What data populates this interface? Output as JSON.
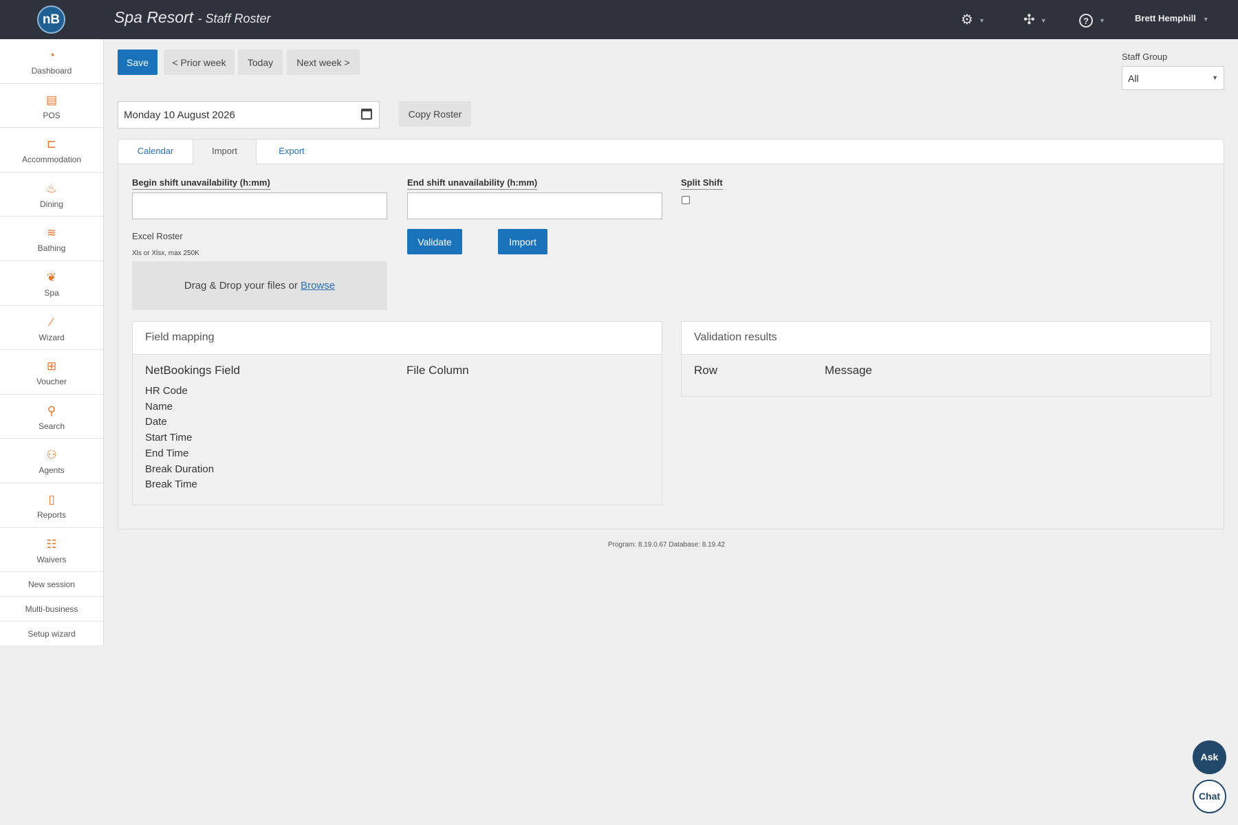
{
  "header": {
    "logo_text": "nB",
    "title": "Spa Resort",
    "subtitle": "- Staff Roster",
    "icons": [
      "settings-icon",
      "network-icon",
      "help-icon"
    ],
    "user": "Brett Hemphill"
  },
  "sidebar": {
    "items": [
      {
        "label": "Dashboard",
        "icon": "dashboard-icon",
        "glyph": "◔"
      },
      {
        "label": "POS",
        "icon": "pos-icon",
        "glyph": "▤"
      },
      {
        "label": "Accommodation",
        "icon": "bed-icon",
        "glyph": "⊏"
      },
      {
        "label": "Dining",
        "icon": "dining-icon",
        "glyph": "♨"
      },
      {
        "label": "Bathing",
        "icon": "waves-icon",
        "glyph": "≋"
      },
      {
        "label": "Spa",
        "icon": "lotus-icon",
        "glyph": "❦"
      },
      {
        "label": "Wizard",
        "icon": "magic-wand-icon",
        "glyph": "⁄"
      },
      {
        "label": "Voucher",
        "icon": "gift-icon",
        "glyph": "⊞"
      },
      {
        "label": "Search",
        "icon": "search-icon",
        "glyph": "⚲"
      },
      {
        "label": "Agents",
        "icon": "agents-icon",
        "glyph": "⚇"
      },
      {
        "label": "Reports",
        "icon": "report-icon",
        "glyph": "▯"
      },
      {
        "label": "Waivers",
        "icon": "checklist-icon",
        "glyph": "☷"
      }
    ],
    "links": [
      "New session",
      "Multi-business",
      "Setup wizard"
    ]
  },
  "toolbar": {
    "save": "Save",
    "prior_week": "< Prior week",
    "today": "Today",
    "next_week": "Next week >",
    "copy_roster": "Copy Roster",
    "date_value": "Monday 10 August 2026"
  },
  "staff_group": {
    "label": "Staff Group",
    "selected": "All"
  },
  "tabs": [
    "Calendar",
    "Import",
    "Export"
  ],
  "import": {
    "begin_label": "Begin shift unavailability (h:mm)",
    "end_label": "End shift unavailability (h:mm)",
    "begin_value": "",
    "end_value": "",
    "split_shift_label": "Split Shift",
    "split_shift_checked": false,
    "excel_label": "Excel Roster",
    "excel_hint": "Xls or Xlsx, max 250K",
    "drop_text": "Drag & Drop your files or",
    "browse": "Browse",
    "validate": "Validate",
    "import": "Import"
  },
  "field_mapping": {
    "title": "Field mapping",
    "col1": "NetBookings Field",
    "col2": "File Column",
    "rows": [
      "HR Code",
      "Name",
      "Date",
      "Start Time",
      "End Time",
      "Break Duration",
      "Break Time"
    ]
  },
  "validation": {
    "title": "Validation results",
    "col1": "Row",
    "col2": "Message"
  },
  "footer": {
    "version": "Program: 8.19.0.67 Database: 8.19.42"
  },
  "widgets": {
    "ask": "Ask",
    "chat": "Chat"
  },
  "colors": {
    "topbar": "#2e323d",
    "primary": "#1a72bb",
    "accent": "#e8742b",
    "link": "#2a6fb5"
  }
}
